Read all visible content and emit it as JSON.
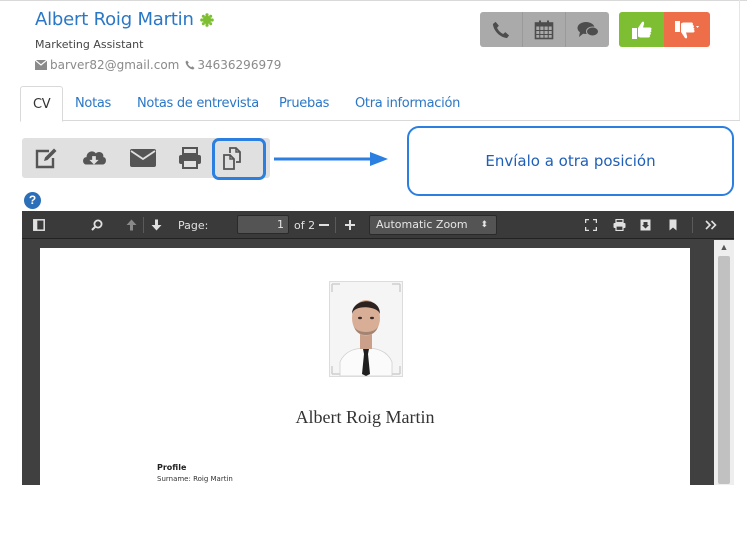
{
  "candidate": {
    "name": "Albert Roig Martin",
    "role": "Marketing Assistant",
    "email": "barver82@gmail.com",
    "phone": "34636296979",
    "status_color": "#7dbe33"
  },
  "actions": {
    "icons": [
      "phone-icon",
      "calendar-icon",
      "chat-icon",
      "thumbs-up-icon",
      "thumbs-down-icon"
    ],
    "approve_color": "#7dbe33",
    "reject_color": "#ee6e4a"
  },
  "tabs": [
    {
      "label": "CV",
      "active": true
    },
    {
      "label": "Notas"
    },
    {
      "label": "Notas de entrevista"
    },
    {
      "label": "Pruebas"
    },
    {
      "label": "Otra información"
    }
  ],
  "toolbar": {
    "icons": [
      "edit-icon",
      "download-icon",
      "email-icon",
      "print-icon",
      "copy-to-position-icon"
    ],
    "highlighted": "copy-to-position-icon"
  },
  "callout": {
    "text": "Envíalo a otra posición",
    "accent_color": "#2a7fe0"
  },
  "help": {
    "label": "?"
  },
  "viewer": {
    "page_label": "Page:",
    "page_value": "1",
    "page_total": "of 2",
    "zoom_value": "Automatic Zoom",
    "document": {
      "name": "Albert Roig Martin",
      "section": "Profile",
      "first_line": "Surname: Roig Martin"
    }
  }
}
